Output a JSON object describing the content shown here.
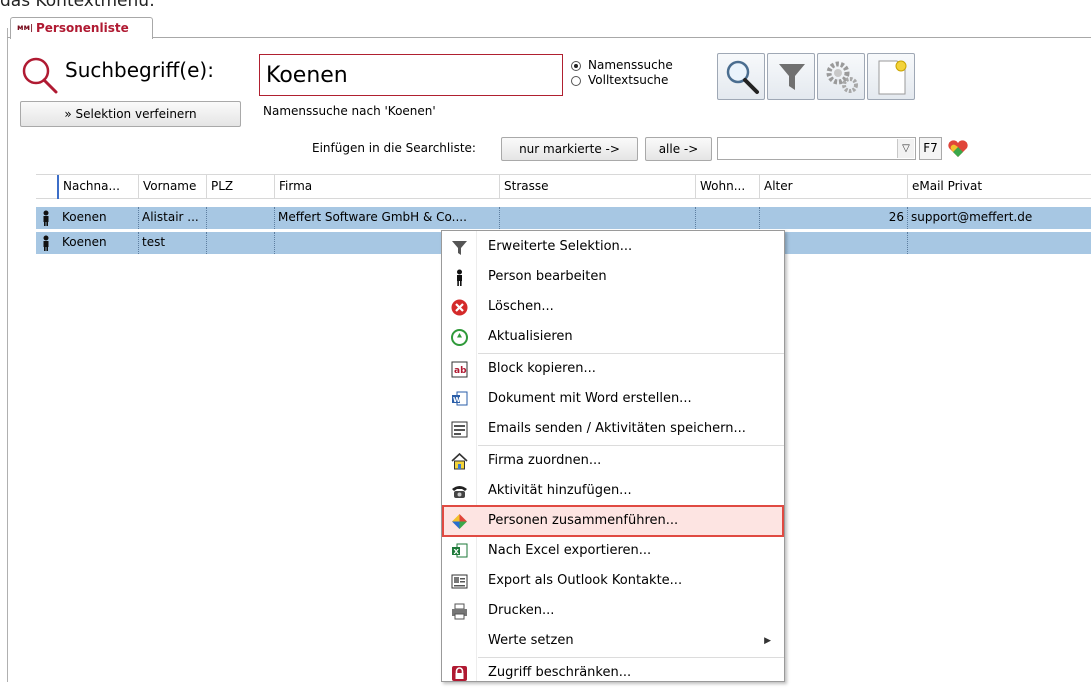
{
  "caption": "das Kontextmenü:",
  "tab": {
    "label": "Personenliste",
    "icon": "person-list-icon"
  },
  "search": {
    "label": "Suchbegriff(e):",
    "value": "Koenen",
    "status": "Namenssuche nach 'Koenen'",
    "refine_label": "» Selektion verfeinern",
    "modes": [
      {
        "label": "Namenssuche",
        "selected": true
      },
      {
        "label": "Volltextsuche",
        "selected": false
      }
    ]
  },
  "toolbar": {
    "buttons": [
      "search-icon",
      "filter-icon",
      "gears-icon",
      "new-document-icon"
    ]
  },
  "insert": {
    "label": "Einfügen in die Searchliste:",
    "marked_label": "nur markierte ->",
    "all_label": "alle ->",
    "combo_value": "",
    "f7_label": "F7"
  },
  "grid": {
    "columns": [
      "Nachna...",
      "Vorname",
      "PLZ",
      "Firma",
      "Strasse",
      "Wohn...",
      "Alter",
      "eMail Privat"
    ],
    "rows": [
      {
        "nachname": "Koenen",
        "vorname": "Alistair ...",
        "plz": "",
        "firma": "Meffert Software GmbH & Co....",
        "strasse": "",
        "wohnort": "",
        "alter": "26",
        "email": "support@meffert.de"
      },
      {
        "nachname": "Koenen",
        "vorname": "test",
        "plz": "",
        "firma": "",
        "strasse": "",
        "wohnort": "",
        "alter": "",
        "email": ""
      }
    ]
  },
  "context_menu": {
    "items": [
      {
        "label": "Erweiterte Selektion...",
        "icon": "funnel-icon"
      },
      {
        "label": "Person bearbeiten",
        "icon": "person-icon"
      },
      {
        "label": "Löschen...",
        "icon": "delete-icon"
      },
      {
        "label": "Aktualisieren",
        "icon": "refresh-icon"
      },
      {
        "label": "Block kopieren...",
        "icon": "copy-block-icon"
      },
      {
        "label": "Dokument mit Word erstellen...",
        "icon": "word-icon"
      },
      {
        "label": "Emails senden / Aktivitäten speichern...",
        "icon": "email-icon"
      },
      {
        "label": "Firma zuordnen...",
        "icon": "house-icon"
      },
      {
        "label": "Aktivität hinzufügen...",
        "icon": "phone-icon"
      },
      {
        "label": "Personen zusammenführen...",
        "icon": "merge-icon",
        "highlighted": true
      },
      {
        "label": "Nach Excel exportieren...",
        "icon": "excel-icon"
      },
      {
        "label": "Export als Outlook Kontakte...",
        "icon": "outlook-contact-icon"
      },
      {
        "label": "Drucken...",
        "icon": "printer-icon"
      },
      {
        "label": "Werte setzen",
        "icon": "",
        "submenu": true
      },
      {
        "label": "Zugriff beschränken...",
        "icon": "lock-icon"
      }
    ]
  },
  "colors": {
    "accent_red": "#b01a32",
    "row_selected": "#a7c7e3",
    "highlight_border": "#e04a42"
  }
}
